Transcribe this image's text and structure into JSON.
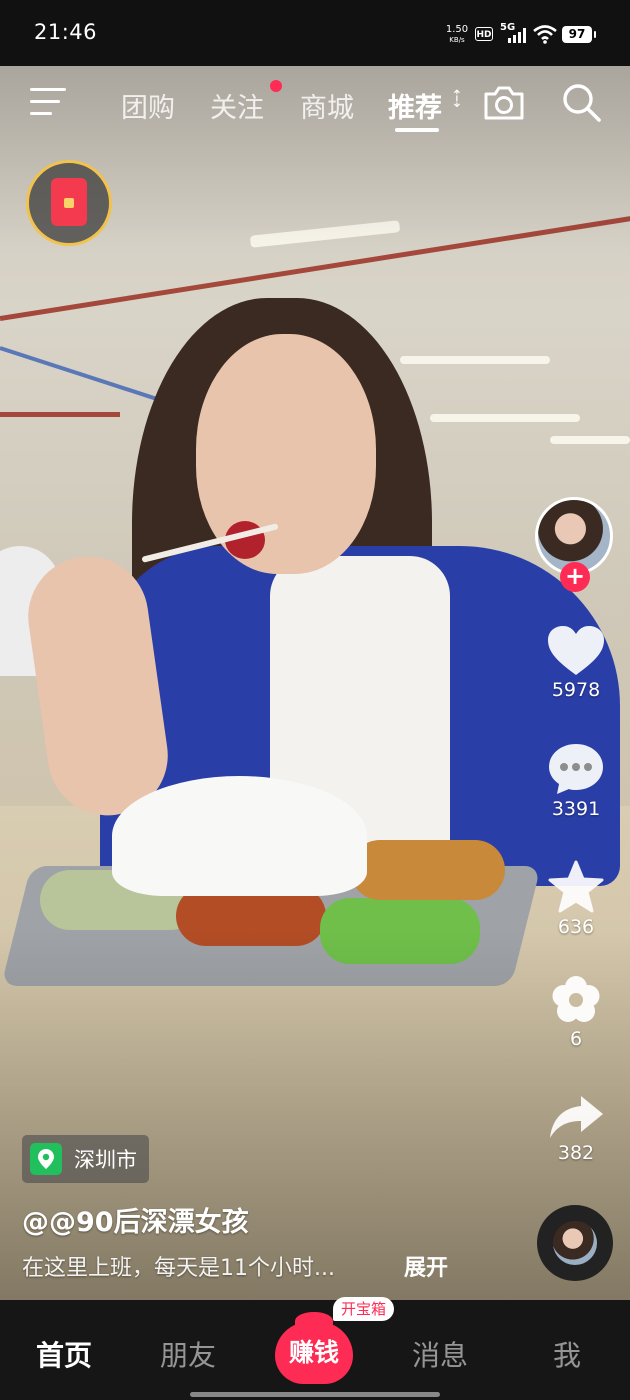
{
  "status_bar": {
    "time": "21:46",
    "net_speed_value": "1.50",
    "net_speed_unit": "KB/s",
    "hd": "HD",
    "network": "5G",
    "battery": "97"
  },
  "top_nav": {
    "tabs": [
      {
        "label": "团购",
        "active": false
      },
      {
        "label": "关注",
        "active": false,
        "has_dot": true
      },
      {
        "label": "商城",
        "active": false
      },
      {
        "label": "推荐",
        "active": true
      }
    ],
    "icons": [
      "menu-icon",
      "camera-icon",
      "search-icon"
    ]
  },
  "actions": {
    "likes": "5978",
    "comments": "3391",
    "favorites": "636",
    "flowers": "6",
    "shares": "382"
  },
  "video_info": {
    "location": "深圳市",
    "author": "@@90后深漂女孩",
    "caption": "在这里上班，每天是11个小时...",
    "expand": "展开"
  },
  "bottom_nav": {
    "home": "首页",
    "friends": "朋友",
    "earn": "赚钱",
    "treasure_badge": "开宝箱",
    "messages": "消息",
    "me": "我"
  },
  "colors": {
    "accent": "#fe2c55",
    "location_pin": "#21c05c",
    "nav_background": "#161616"
  }
}
